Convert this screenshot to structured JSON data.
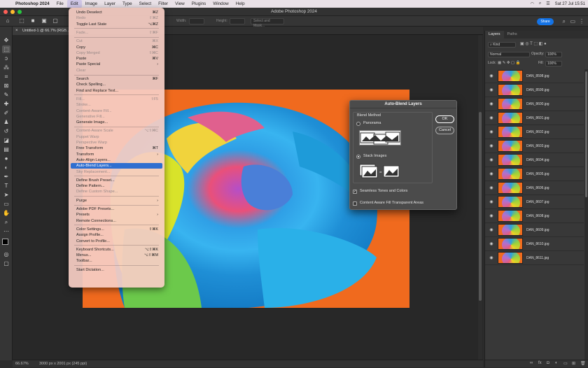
{
  "menubar": {
    "apple_icon": "apple-icon",
    "app_name": "Photoshop 2024",
    "items": [
      "File",
      "Edit",
      "Image",
      "Layer",
      "Type",
      "Select",
      "Filter",
      "View",
      "Plugins",
      "Window",
      "Help"
    ],
    "clock": "Sat 27 Jul  15:51"
  },
  "window": {
    "title": "Adobe Photoshop 2024"
  },
  "options_bar": {
    "width_label": "Width:",
    "height_label": "Height:",
    "select_mask": "Select and Mask...",
    "share": "Share"
  },
  "document_tab": {
    "label": "Untitled-1 @ 66.7% (RGB..."
  },
  "status": {
    "zoom": "66.67%",
    "info": "3000 px x 2001 px (245 ppi)"
  },
  "edit_menu": [
    {
      "label": "Undo Deselect",
      "shortcut": "⌘Z",
      "enabled": true
    },
    {
      "label": "Redo",
      "shortcut": "⇧⌘Z",
      "enabled": false
    },
    {
      "label": "Toggle Last State",
      "shortcut": "⌥⌘Z",
      "enabled": true
    },
    {
      "sep": true
    },
    {
      "label": "Fade...",
      "shortcut": "⇧⌘F",
      "enabled": false
    },
    {
      "sep": true
    },
    {
      "label": "Cut",
      "shortcut": "⌘X",
      "enabled": false
    },
    {
      "label": "Copy",
      "shortcut": "⌘C",
      "enabled": true
    },
    {
      "label": "Copy Merged",
      "shortcut": "⇧⌘C",
      "enabled": false
    },
    {
      "label": "Paste",
      "shortcut": "⌘V",
      "enabled": true
    },
    {
      "label": "Paste Special",
      "shortcut": "›",
      "enabled": true
    },
    {
      "label": "Clear",
      "shortcut": "",
      "enabled": false
    },
    {
      "sep": true
    },
    {
      "label": "Search",
      "shortcut": "⌘F",
      "enabled": true
    },
    {
      "label": "Check Spelling...",
      "shortcut": "",
      "enabled": true
    },
    {
      "label": "Find and Replace Text...",
      "shortcut": "",
      "enabled": true
    },
    {
      "sep": true
    },
    {
      "label": "Fill...",
      "shortcut": "⇧F5",
      "enabled": false
    },
    {
      "label": "Stroke...",
      "shortcut": "",
      "enabled": false
    },
    {
      "label": "Content-Aware Fill...",
      "shortcut": "",
      "enabled": false
    },
    {
      "label": "Generative Fill...",
      "shortcut": "",
      "enabled": false
    },
    {
      "label": "Generate Image...",
      "shortcut": "",
      "enabled": true
    },
    {
      "sep": true
    },
    {
      "label": "Content-Aware Scale",
      "shortcut": "⌥⇧⌘C",
      "enabled": false
    },
    {
      "label": "Puppet Warp",
      "shortcut": "",
      "enabled": false
    },
    {
      "label": "Perspective Warp",
      "shortcut": "",
      "enabled": false
    },
    {
      "label": "Free Transform",
      "shortcut": "⌘T",
      "enabled": true
    },
    {
      "label": "Transform",
      "shortcut": "›",
      "enabled": true
    },
    {
      "label": "Auto-Align Layers...",
      "shortcut": "",
      "enabled": true
    },
    {
      "label": "Auto-Blend Layers...",
      "shortcut": "",
      "enabled": true,
      "highlight": true
    },
    {
      "label": "Sky Replacement...",
      "shortcut": "",
      "enabled": false
    },
    {
      "sep": true
    },
    {
      "label": "Define Brush Preset...",
      "shortcut": "",
      "enabled": true
    },
    {
      "label": "Define Pattern...",
      "shortcut": "",
      "enabled": true
    },
    {
      "label": "Define Custom Shape...",
      "shortcut": "",
      "enabled": false
    },
    {
      "sep": true
    },
    {
      "label": "Purge",
      "shortcut": "›",
      "enabled": true
    },
    {
      "sep": true
    },
    {
      "label": "Adobe PDF Presets...",
      "shortcut": "",
      "enabled": true
    },
    {
      "label": "Presets",
      "shortcut": "›",
      "enabled": true
    },
    {
      "label": "Remote Connections...",
      "shortcut": "",
      "enabled": true
    },
    {
      "sep": true
    },
    {
      "label": "Color Settings...",
      "shortcut": "⇧⌘K",
      "enabled": true
    },
    {
      "label": "Assign Profile...",
      "shortcut": "",
      "enabled": true
    },
    {
      "label": "Convert to Profile...",
      "shortcut": "",
      "enabled": true
    },
    {
      "sep": true
    },
    {
      "label": "Keyboard Shortcuts...",
      "shortcut": "⌥⇧⌘K",
      "enabled": true
    },
    {
      "label": "Menus...",
      "shortcut": "⌥⇧⌘M",
      "enabled": true
    },
    {
      "label": "Toolbar...",
      "shortcut": "",
      "enabled": true
    },
    {
      "sep": true
    },
    {
      "label": "Start Dictation...",
      "shortcut": "",
      "enabled": true
    }
  ],
  "dialog": {
    "title": "Auto-Blend Layers",
    "group_label": "Blend Method",
    "options": [
      "Panorama",
      "Stack Images"
    ],
    "selected": "Stack Images",
    "ok": "OK",
    "cancel": "Cancel",
    "checkboxes": [
      {
        "label": "Seamless Tones and Colors",
        "checked": true
      },
      {
        "label": "Content Aware Fill Transparent Areas",
        "checked": false
      }
    ]
  },
  "layers_panel": {
    "tabs": [
      "Layers",
      "Paths"
    ],
    "active_tab": "Layers",
    "filter": "Kind",
    "blend_mode": "Normal",
    "opacity_label": "Opacity:",
    "opacity": "100%",
    "lock_label": "Lock:",
    "fill_label": "Fill:",
    "fill": "100%",
    "layers": [
      "DAN_8598.jpg",
      "DAN_8599.jpg",
      "DAN_8600.jpg",
      "DAN_8601.jpg",
      "DAN_8602.jpg",
      "DAN_8603.jpg",
      "DAN_8604.jpg",
      "DAN_8605.jpg",
      "DAN_8606.jpg",
      "DAN_8607.jpg",
      "DAN_8608.jpg",
      "DAN_8609.jpg",
      "DAN_8610.jpg",
      "DAN_8611.jpg"
    ]
  },
  "colors": {
    "canvas_bg": "#f06a1e",
    "accent": "#1473e6",
    "menu_highlight": "#2f6fd0"
  }
}
